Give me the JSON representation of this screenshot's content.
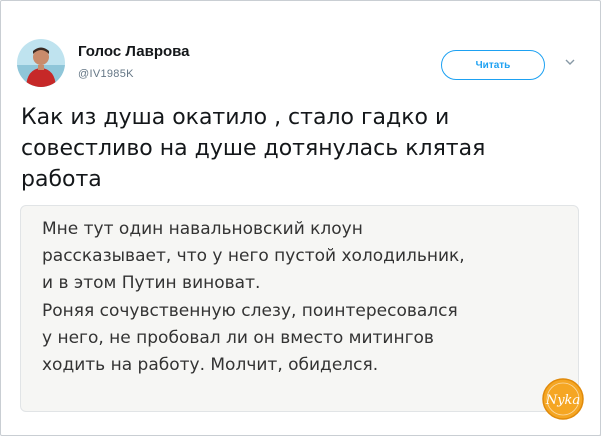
{
  "tweet": {
    "author": {
      "display_name": "Голос Лаврова",
      "handle": "@IV1985K"
    },
    "follow_button_label": "Читать",
    "text_lines": [
      "Как из душа окатило , стало гадко и",
      "совестливо на душе дотянулась клятая",
      "работа"
    ],
    "quoted_image": {
      "text_lines": [
        "Мне тут один навальновский клоун",
        "рассказывает, что у него пустой холодильник,",
        "и в этом Путин виноват.",
        "Роняя сочувственную слезу, поинтересовался",
        "у него, не пробовал ли он вместо митингов",
        "ходить на работу. Молчит, обиделся."
      ]
    }
  },
  "watermark": {
    "text": "Nyka"
  },
  "colors": {
    "accent": "#1da1f2",
    "text": "#14171a",
    "muted": "#657786",
    "quote_bg": "#f6f6f4",
    "watermark": "#f5a623"
  }
}
